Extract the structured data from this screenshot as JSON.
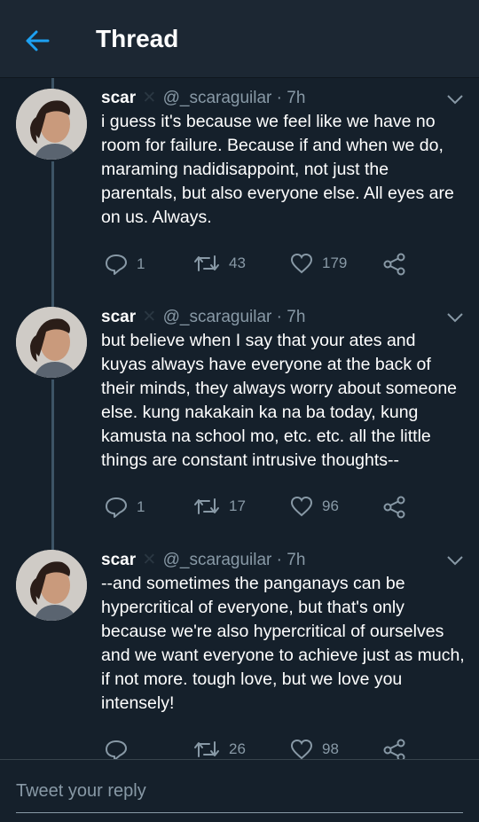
{
  "header": {
    "title": "Thread",
    "back_icon": "arrow-left-icon"
  },
  "colors": {
    "background": "#15202b",
    "header": "#1c2733",
    "accent": "#1da1f2",
    "muted": "#8899a6"
  },
  "tweets": [
    {
      "name": "scar",
      "handle": "@_scaraguilar",
      "time": "· 7h",
      "text": "i guess it's because we feel like we have no room for failure. Because if and when we do, maraming nadidisappoint, not just the parentals, but also everyone else. All eyes are on us. Always.",
      "replies": "1",
      "retweets": "43",
      "likes": "179"
    },
    {
      "name": "scar",
      "handle": "@_scaraguilar",
      "time": "· 7h",
      "text": "but believe when I say that your ates and kuyas always have everyone at the back of their minds, they always worry about someone else. kung nakakain ka na ba today, kung kamusta na school mo, etc. etc. all the little things are constant intrusive thoughts--",
      "replies": "1",
      "retweets": "17",
      "likes": "96"
    },
    {
      "name": "scar",
      "handle": "@_scaraguilar",
      "time": "· 7h",
      "text": "--and sometimes the panganays can be hypercritical of everyone, but that's only because we're also hypercritical of ourselves and we want everyone to achieve just as much, if not more. tough love, but we love you intensely!",
      "replies": "",
      "retweets": "26",
      "likes": "98"
    }
  ],
  "compose": {
    "placeholder": "Tweet your reply"
  }
}
